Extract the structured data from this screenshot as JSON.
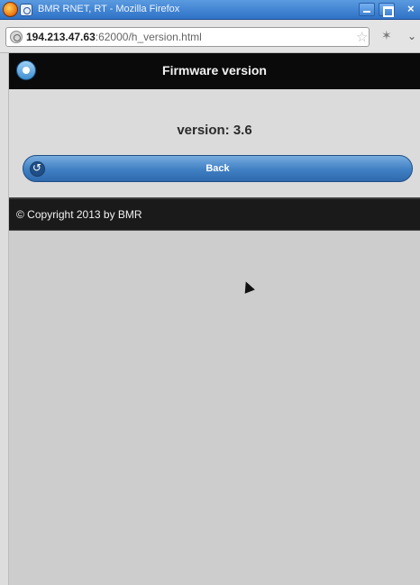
{
  "window": {
    "title": "BMR RNET, RT - Mozilla Firefox"
  },
  "browser": {
    "url_host": "194.213.47.63",
    "url_rest": ":62000/h_version.html"
  },
  "app": {
    "title": "Firmware version",
    "version_text": "version: 3.6",
    "back_label": "Back",
    "footer_text": "© Copyright 2013 by BMR"
  }
}
